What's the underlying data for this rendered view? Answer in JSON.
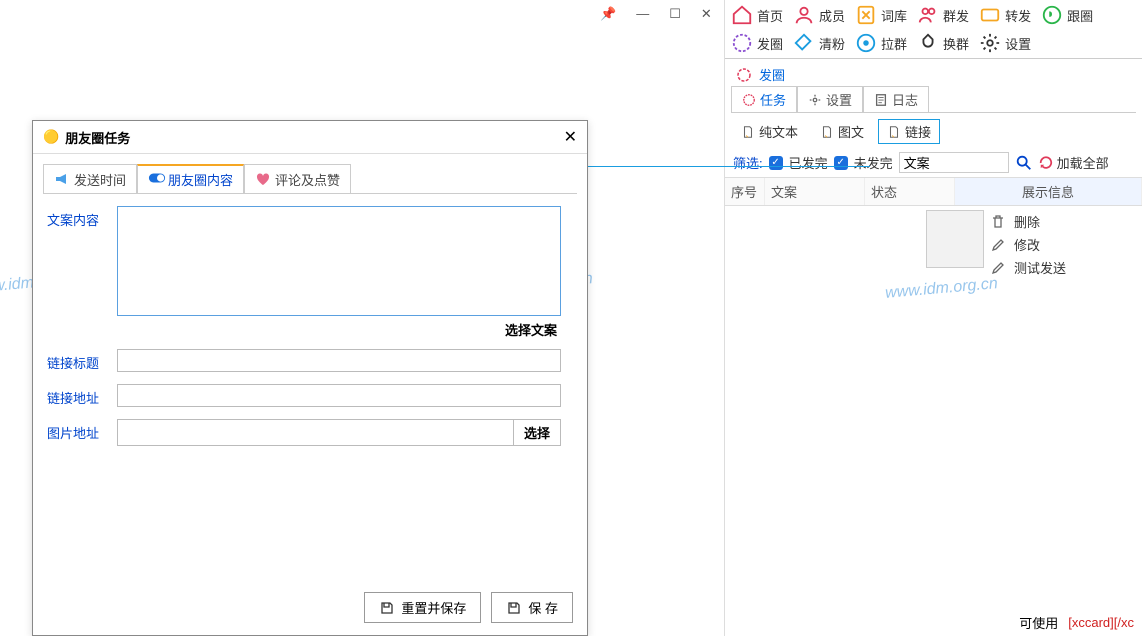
{
  "window_controls": {
    "pin": "📌",
    "min": "—",
    "max": "☐",
    "close": "✕"
  },
  "toolbar": [
    {
      "id": "home",
      "label": "首页",
      "color": "#e03a5a"
    },
    {
      "id": "members",
      "label": "成员",
      "color": "#e03a5a"
    },
    {
      "id": "lexicon",
      "label": "词库",
      "color": "#f5a623"
    },
    {
      "id": "mass",
      "label": "群发",
      "color": "#e03a5a"
    },
    {
      "id": "forward",
      "label": "转发",
      "color": "#f5a623"
    },
    {
      "id": "follow",
      "label": "跟圈",
      "color": "#2ab54a"
    },
    {
      "id": "post",
      "label": "发圈",
      "color": "#8a4fd0"
    },
    {
      "id": "clean",
      "label": "清粉",
      "color": "#1a9de0"
    },
    {
      "id": "pull",
      "label": "拉群",
      "color": "#1a9de0"
    },
    {
      "id": "swap",
      "label": "换群",
      "color": "#333"
    },
    {
      "id": "settings",
      "label": "设置",
      "color": "#333"
    }
  ],
  "section": {
    "title": "发圈"
  },
  "subtabs": [
    {
      "id": "task",
      "label": "任务",
      "active": true
    },
    {
      "id": "cfg",
      "label": "设置",
      "active": false
    },
    {
      "id": "log",
      "label": "日志",
      "active": false
    }
  ],
  "typetabs": [
    {
      "id": "text",
      "label": "纯文本",
      "sel": false
    },
    {
      "id": "imgtxt",
      "label": "图文",
      "sel": false
    },
    {
      "id": "link",
      "label": "链接",
      "sel": true
    }
  ],
  "filter": {
    "label": "筛选:",
    "done": "已发完",
    "undone": "未发完",
    "input": "文案",
    "reload": "加载全部"
  },
  "grid": {
    "headers": {
      "no": "序号",
      "txt": "文案",
      "st": "状态",
      "info": "展示信息"
    },
    "actions": [
      {
        "id": "del",
        "label": "删除"
      },
      {
        "id": "edit",
        "label": "修改"
      },
      {
        "id": "test",
        "label": "测试发送"
      }
    ]
  },
  "dialog": {
    "title": "朋友圈任务",
    "tabs": [
      {
        "id": "time",
        "label": "发送时间",
        "active": false
      },
      {
        "id": "content",
        "label": "朋友圈内容",
        "active": true
      },
      {
        "id": "like",
        "label": "评论及点赞",
        "active": false
      }
    ],
    "fields": {
      "content_label": "文案内容",
      "select_text": "选择文案",
      "link_title": "链接标题",
      "link_url": "链接地址",
      "img_url": "图片地址",
      "choose": "选择"
    },
    "buttons": {
      "reset": "重置并保存",
      "save": "保 存"
    }
  },
  "footer": {
    "use": "可使用",
    "tag": "[xccard][/xc"
  },
  "watermark": "www.idm.org.cn"
}
